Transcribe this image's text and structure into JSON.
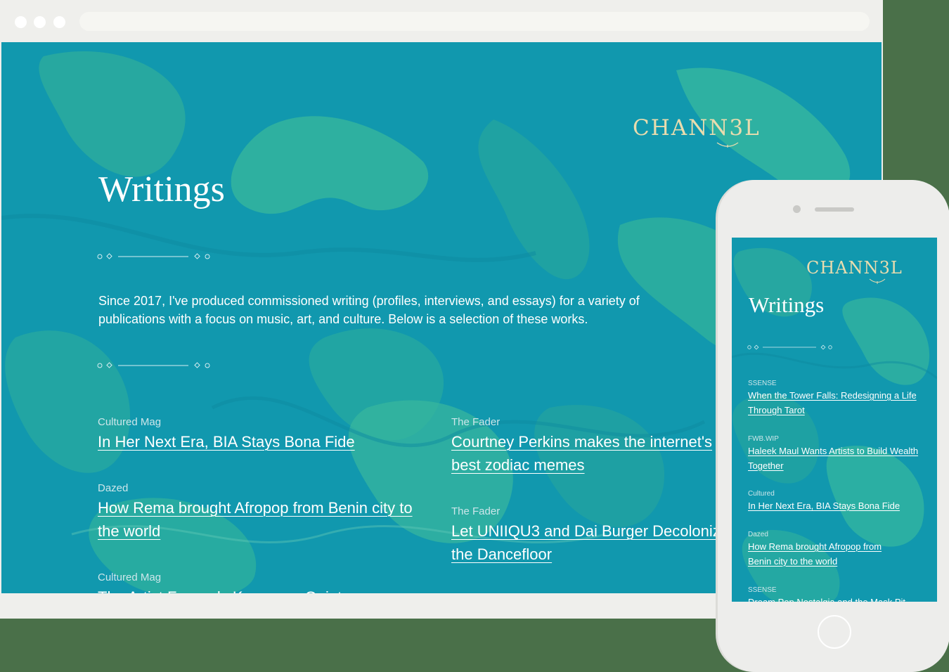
{
  "colors": {
    "background": "#4a7049",
    "teal": "#1198ae",
    "green": "#34b59a",
    "logo": "#e9dcae",
    "frame": "#efefec"
  },
  "logo": {
    "text": "CHANN3L"
  },
  "page": {
    "title": "Writings",
    "intro": "Since 2017, I've produced commissioned writing (profiles, interviews, and essays) for a variety of publications with a focus on music, art, and culture. Below is a selection of these works."
  },
  "articles_left": [
    {
      "publication": "Cultured Mag",
      "title": "In Her Next Era, BIA Stays Bona Fide"
    },
    {
      "publication": "Dazed",
      "title": "How Rema brought Afropop from Benin city to the world"
    },
    {
      "publication": "Cultured Mag",
      "title": "The Artist Formerly Known as Quiet"
    }
  ],
  "articles_right": [
    {
      "publication": "The Fader",
      "title": "Courtney Perkins makes the internet's best zodiac memes"
    },
    {
      "publication": "The Fader",
      "title": "Let UNIIQU3 and Dai Burger Decolonize the Dancefloor"
    }
  ],
  "mobile": {
    "title": "Writings",
    "articles": [
      {
        "publication": "SSENSE",
        "title": "When the Tower Falls: Redesigning a Life Through Tarot"
      },
      {
        "publication": "FWB.WIP",
        "title": "Haleek Maul Wants Artists to Build Wealth Together"
      },
      {
        "publication": "Cultured",
        "title": "In Her Next Era, BIA Stays Bona Fide"
      },
      {
        "publication": "Dazed",
        "title": "How Rema brought Afropop from Benin city to the world"
      },
      {
        "publication": "SSENSE",
        "title": "Dream Pop Nostalgia and the Mask Pit"
      }
    ]
  },
  "icons": [
    "window-control-dot",
    "divider-ornament",
    "phone-camera",
    "phone-speaker",
    "home-button"
  ]
}
